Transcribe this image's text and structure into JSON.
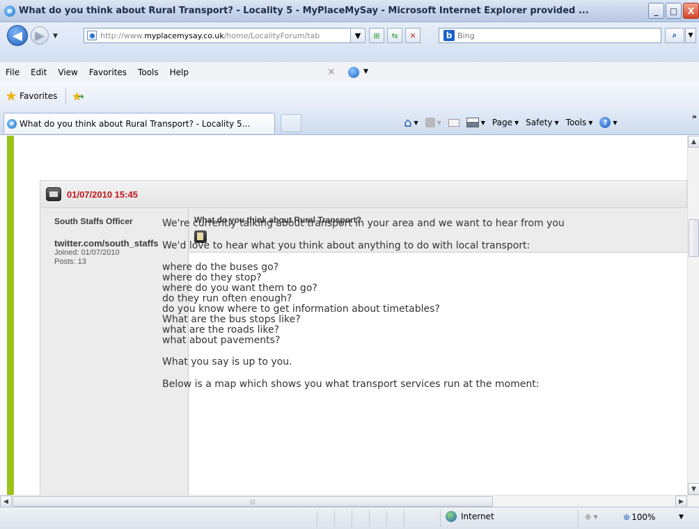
{
  "window": {
    "title": "What do you think about Rural Transport? - Locality 5 - MyPlaceMySay - Microsoft Internet Explorer provided ...",
    "minimize": "_",
    "maximize": "□",
    "close": "X"
  },
  "addressbar": {
    "url_prefix": "http://www.",
    "url_domain": "myplacemysay.co.uk",
    "url_rest": "/home/LocalityForum/tab",
    "search_provider": "Bing",
    "search_placeholder": "Bing"
  },
  "menubar": {
    "items": [
      "File",
      "Edit",
      "View",
      "Favorites",
      "Tools",
      "Help"
    ]
  },
  "favorites": {
    "label": "Favorites"
  },
  "tabs": {
    "active_title": "What do you think about Rural Transport? - Locality 5..."
  },
  "commandbar": {
    "page": "Page",
    "safety": "Safety",
    "tools": "Tools"
  },
  "post": {
    "date": "01/07/2010 15:45",
    "author": {
      "name": "South Staffs Officer",
      "site": "twitter.com/south_staffs",
      "joined": "Joined: 01/07/2010",
      "posts": "Posts: 13"
    },
    "subject": "What do you think about Rural Transport?",
    "body": {
      "intro": "We're currently talking about transport in your area and we want to hear from you",
      "prompt": "We'd love to hear what you think about anything to do with local transport:",
      "questions": [
        "where do the buses go?",
        "where do they stop?",
        "where do you want them to go?",
        "do they run often enough?",
        "do you know where to get information about timetables?",
        "What are the bus stops like?",
        "what are the roads like?",
        "what about pavements?"
      ],
      "closing": "What you say is up to you.",
      "map_intro": "Below is a map which shows you what transport services run at the moment:"
    }
  },
  "statusbar": {
    "zone": "Internet",
    "zoom": "100%"
  }
}
